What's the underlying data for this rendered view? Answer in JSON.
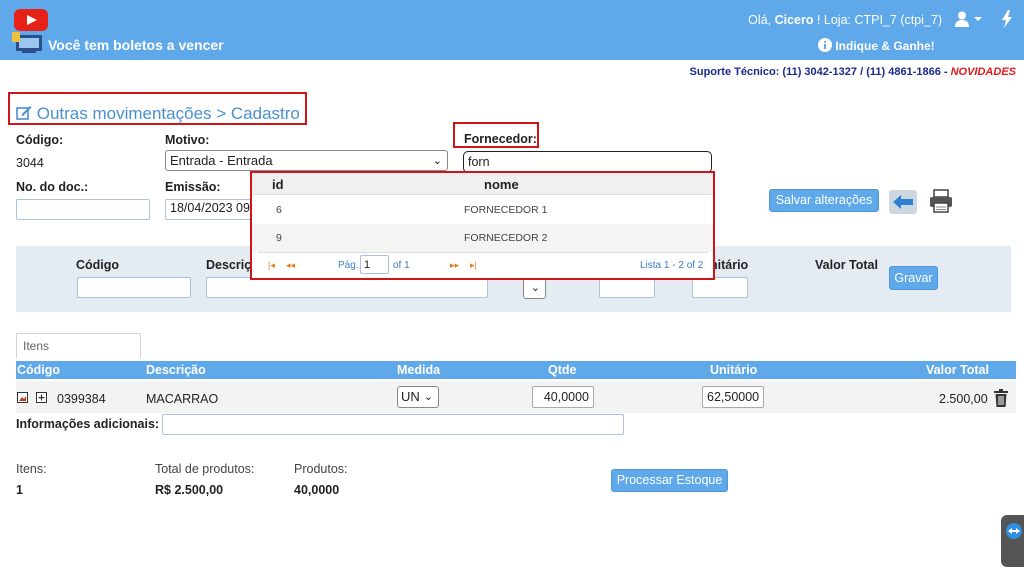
{
  "header": {
    "boleto_text": "Você tem boletos a vencer",
    "greeting_prefix": "Olá, ",
    "user_name": "Cicero",
    "greeting_suffix": " !  Loja: CTPI_7 (ctpi_7)",
    "indique": "Indique & Ganhe!",
    "icons": [
      "youtube-icon",
      "boleto-icon",
      "user-icon",
      "chevron-down-icon",
      "bolt-icon",
      "info-icon"
    ],
    "bg_color": "#5fa8ea"
  },
  "suporte": {
    "text": "Suporte Técnico: (11) 3042-1327 / (11) 4861-1866 - ",
    "novidades": "NOVIDADES"
  },
  "page": {
    "title": "Outras movimentações > Cadastro"
  },
  "form": {
    "codigo_label": "Código:",
    "codigo_value": "3044",
    "motivo_label": "Motivo:",
    "motivo_value": "Entrada - Entrada",
    "fornecedor_label": "Fornecedor:",
    "fornecedor_value": "forn",
    "no_doc_label": "No. do doc.:",
    "no_doc_value": "",
    "emissao_label": "Emissão:",
    "emissao_value": "18/04/2023 09",
    "save_label": "Salvar alterações"
  },
  "dropdown": {
    "col_id": "id",
    "col_nome": "nome",
    "rows": [
      {
        "id": "6",
        "nome": "FORNECEDOR 1"
      },
      {
        "id": "9",
        "nome": "FORNECEDOR 2"
      }
    ],
    "pag_label": "Pág.",
    "page_value": "1",
    "of_label": "of 1",
    "lista_label": "Lista 1 - 2 of 2"
  },
  "entry_panel": {
    "codigo_label": "Código",
    "descricao_label": "Descriç",
    "unitario_label": "nitário",
    "valor_total_label": "Valor Total",
    "gravar_label": "Gravar"
  },
  "items": {
    "tab_label": "Itens",
    "columns": [
      "Código",
      "Descrição",
      "Medida",
      "Qtde",
      "Unitário",
      "Valor Total"
    ],
    "rows": [
      {
        "codigo": "0399384",
        "descricao": "MACARRAO",
        "medida": "UN",
        "qtde": "40,0000",
        "unitario": "62,500000",
        "valor_total": "2.500,00"
      }
    ],
    "info_label": "Informações adicionais:",
    "info_value": ""
  },
  "summary": {
    "itens_label": "Itens:",
    "itens_value": "1",
    "total_label": "Total de produtos:",
    "total_value": "R$ 2.500,00",
    "produtos_label": "Produtos:",
    "produtos_value": "40,0000",
    "processar_label": "Processar Estoque"
  }
}
